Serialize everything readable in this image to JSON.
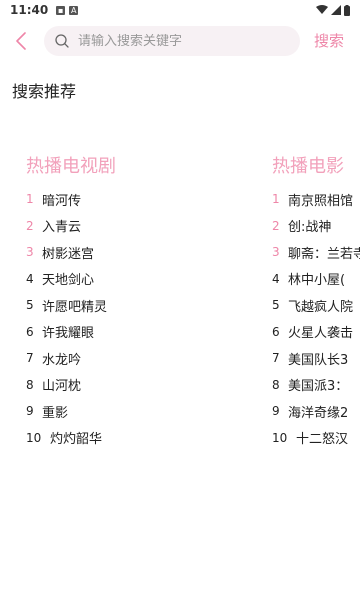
{
  "status": {
    "time": "11:40"
  },
  "search": {
    "placeholder": "请输入搜索关键字",
    "value": "",
    "submit_label": "搜索"
  },
  "section_title": "搜索推荐",
  "tv": {
    "title": "热播电视剧",
    "items": [
      {
        "rank": "1",
        "name": "暗河传"
      },
      {
        "rank": "2",
        "name": "入青云"
      },
      {
        "rank": "3",
        "name": "树影迷宫"
      },
      {
        "rank": "4",
        "name": "天地剑心"
      },
      {
        "rank": "5",
        "name": "许愿吧精灵"
      },
      {
        "rank": "6",
        "name": "许我耀眼"
      },
      {
        "rank": "7",
        "name": "水龙吟"
      },
      {
        "rank": "8",
        "name": "山河枕"
      },
      {
        "rank": "9",
        "name": "重影"
      },
      {
        "rank": "10",
        "name": "灼灼韶华"
      }
    ]
  },
  "movie": {
    "title": "热播电影",
    "items": [
      {
        "rank": "1",
        "name": "南京照相馆"
      },
      {
        "rank": "2",
        "name": "创:战神"
      },
      {
        "rank": "3",
        "name": "聊斋：兰若寺"
      },
      {
        "rank": "4",
        "name": "林中小屋("
      },
      {
        "rank": "5",
        "name": "飞越疯人院"
      },
      {
        "rank": "6",
        "name": "火星人袭击"
      },
      {
        "rank": "7",
        "name": "美国队长3"
      },
      {
        "rank": "8",
        "name": "美国派3："
      },
      {
        "rank": "9",
        "name": "海洋奇缘2"
      },
      {
        "rank": "10",
        "name": "十二怒汉"
      }
    ]
  },
  "colors": {
    "accent": "#ee86a8",
    "title_pink": "#f2a1bb",
    "search_bg": "#f7f1f4"
  }
}
